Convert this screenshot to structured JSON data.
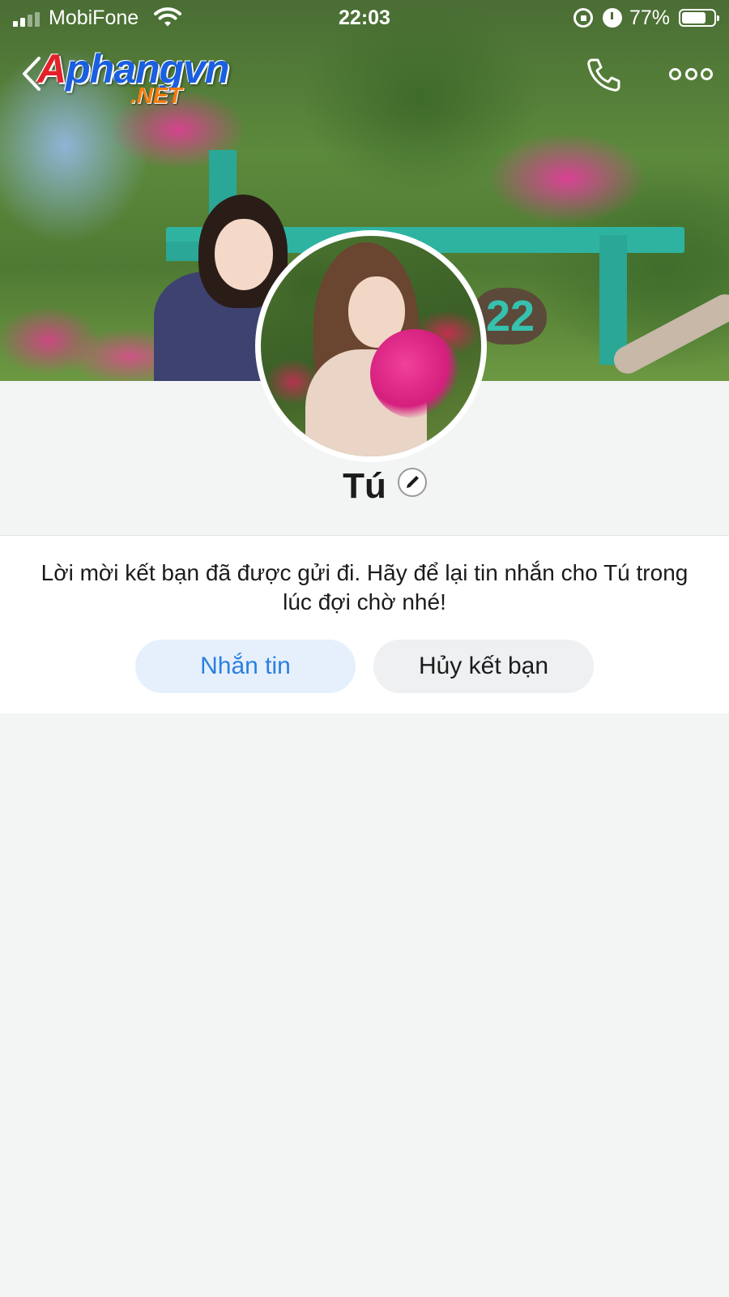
{
  "status_bar": {
    "carrier": "MobiFone",
    "time": "22:03",
    "battery_percent": "77%",
    "battery_level": 0.77,
    "icons": [
      "signal-icon",
      "wifi-icon",
      "rotation-lock-icon",
      "alarm-icon",
      "battery-icon"
    ]
  },
  "watermark": {
    "brand": "Aphangvn",
    "suffix": ".NET"
  },
  "nav": {
    "back_icon": "chevron-left-icon",
    "call_icon": "phone-icon",
    "more_icon": "more-dots-icon"
  },
  "profile": {
    "name": "Tú",
    "edit_icon": "pencil-icon"
  },
  "friend_request": {
    "message": "Lời mời kết bạn đã được gửi đi. Hãy để lại tin nhắn cho Tú trong lúc đợi chờ nhé!",
    "message_button": "Nhắn tin",
    "cancel_button": "Hủy kết bạn"
  },
  "colors": {
    "accent_blue": "#2a7fe0",
    "message_button_bg": "#e6f0fc",
    "cancel_button_bg": "#eef0f2",
    "page_bg": "#f3f4f4"
  }
}
